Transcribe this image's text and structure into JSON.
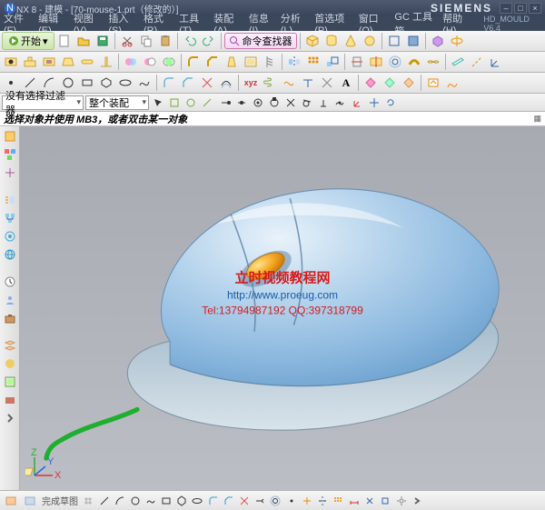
{
  "title": "NX 8 - 建模 - [70-mouse-1.prt（修改的）]",
  "brand": "SIEMENS",
  "menu": [
    "文件(F)",
    "编辑(E)",
    "视图(V)",
    "插入(S)",
    "格式(R)",
    "工具(T)",
    "装配(A)",
    "信息(I)",
    "分析(L)",
    "首选项(P)",
    "窗口(O)",
    "GC 工具箱",
    "帮助(H)"
  ],
  "mould_label": "HD_MOULD  V6.4",
  "start": {
    "label": "开始",
    "arrow": "▾"
  },
  "cmdfinder": "命令查找器",
  "filter1": "没有选择过滤器",
  "filter2": "整个装配",
  "statusline": "选择对象并使用 MB3，或者双击某一对象",
  "bottom_label": "完成草图",
  "watermark": {
    "l1": "立时视频教程网",
    "l2": "http://www.proeug.com",
    "l3": "Tel:13794987192   QQ:397318799"
  },
  "icons": {
    "nx": "nx-icon",
    "save": "save-icon",
    "open": "open-icon",
    "undo": "undo-icon",
    "redo": "redo-icon",
    "copy": "copy-icon",
    "paste": "paste-icon",
    "cut": "cut-icon"
  }
}
